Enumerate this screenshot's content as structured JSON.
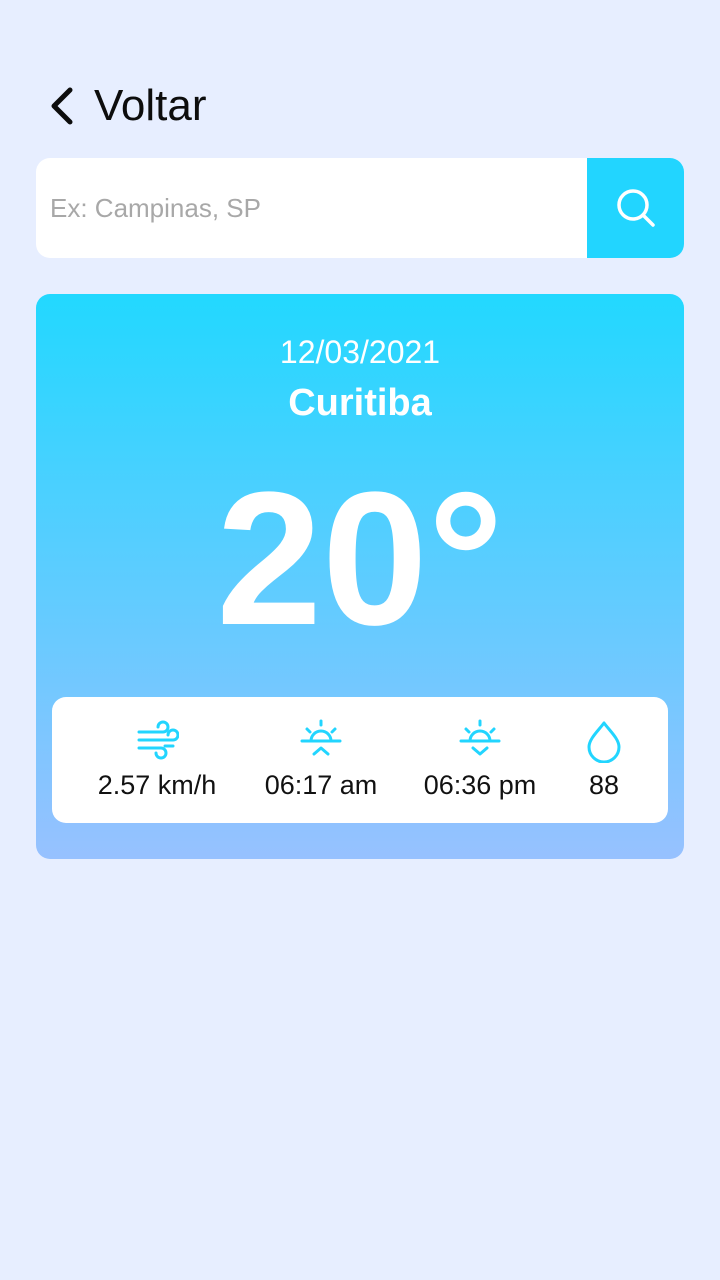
{
  "header": {
    "back_label": "Voltar"
  },
  "search": {
    "placeholder": "Ex: Campinas, SP",
    "value": ""
  },
  "weather": {
    "date": "12/03/2021",
    "city": "Curitiba",
    "temperature": "20°",
    "details": {
      "wind": "2.57 km/h",
      "sunrise": "06:17 am",
      "sunset": "06:36 pm",
      "humidity": "88"
    }
  },
  "icons": {
    "back": "chevron-left-icon",
    "search": "search-icon",
    "wind": "wind-icon",
    "sunrise": "sunrise-icon",
    "sunset": "sunset-icon",
    "humidity": "droplet-icon"
  },
  "colors": {
    "background": "#e7eeff",
    "accent": "#22d5ff",
    "card_gradient_top": "#22d8ff",
    "card_gradient_bottom": "#97c1ff",
    "icon": "#22d5ff"
  }
}
